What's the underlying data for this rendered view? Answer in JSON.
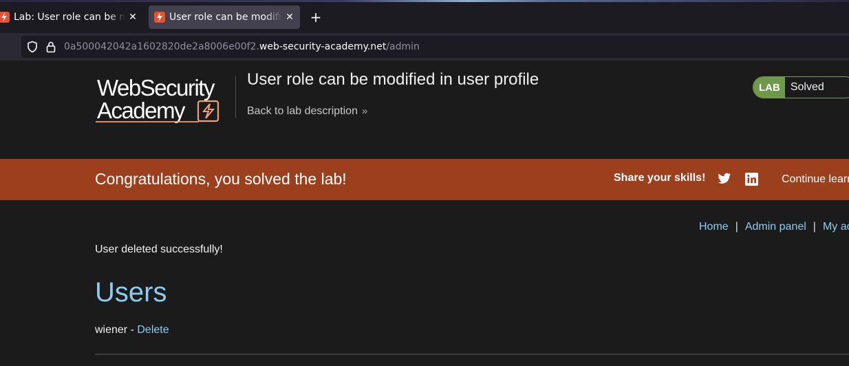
{
  "browser": {
    "tabs": [
      {
        "title": "Lab: User role can be modified in user profile",
        "active": false
      },
      {
        "title": "User role can be modified in user profile",
        "active": true
      }
    ],
    "new_tab_label": "+",
    "close_glyph": "✕",
    "url": {
      "prefix": "0a500042042a1602820de2a8006e00f2.",
      "domain": "web-security-academy.net",
      "path": "/admin"
    }
  },
  "header": {
    "logo_line1": "WebSecurity",
    "logo_line2": "Academy",
    "lab_title": "User role can be modified in user profile",
    "back_link": "Back to lab description",
    "badge_label": "LAB",
    "badge_status": "Solved"
  },
  "banner": {
    "message": "Congratulations, you solved the lab!",
    "share_label": "Share your skills!",
    "continue_label": "Continue learning"
  },
  "nav": {
    "home": "Home",
    "separator": "|",
    "admin_panel": "Admin panel",
    "my_account": "My account"
  },
  "content": {
    "status_message": "User deleted successfully!",
    "heading": "Users",
    "users": [
      {
        "name": "wiener",
        "separator": " - ",
        "action": "Delete"
      }
    ]
  },
  "colors": {
    "banner": "#9c3f1c",
    "link": "#8ecbf0",
    "lab_badge": "#70984a",
    "page_bg": "#1b1b1b"
  },
  "icons": [
    "shield-icon",
    "lock-icon",
    "twitter-icon",
    "linkedin-icon",
    "chevron-right-icon",
    "close-icon",
    "plus-icon"
  ]
}
